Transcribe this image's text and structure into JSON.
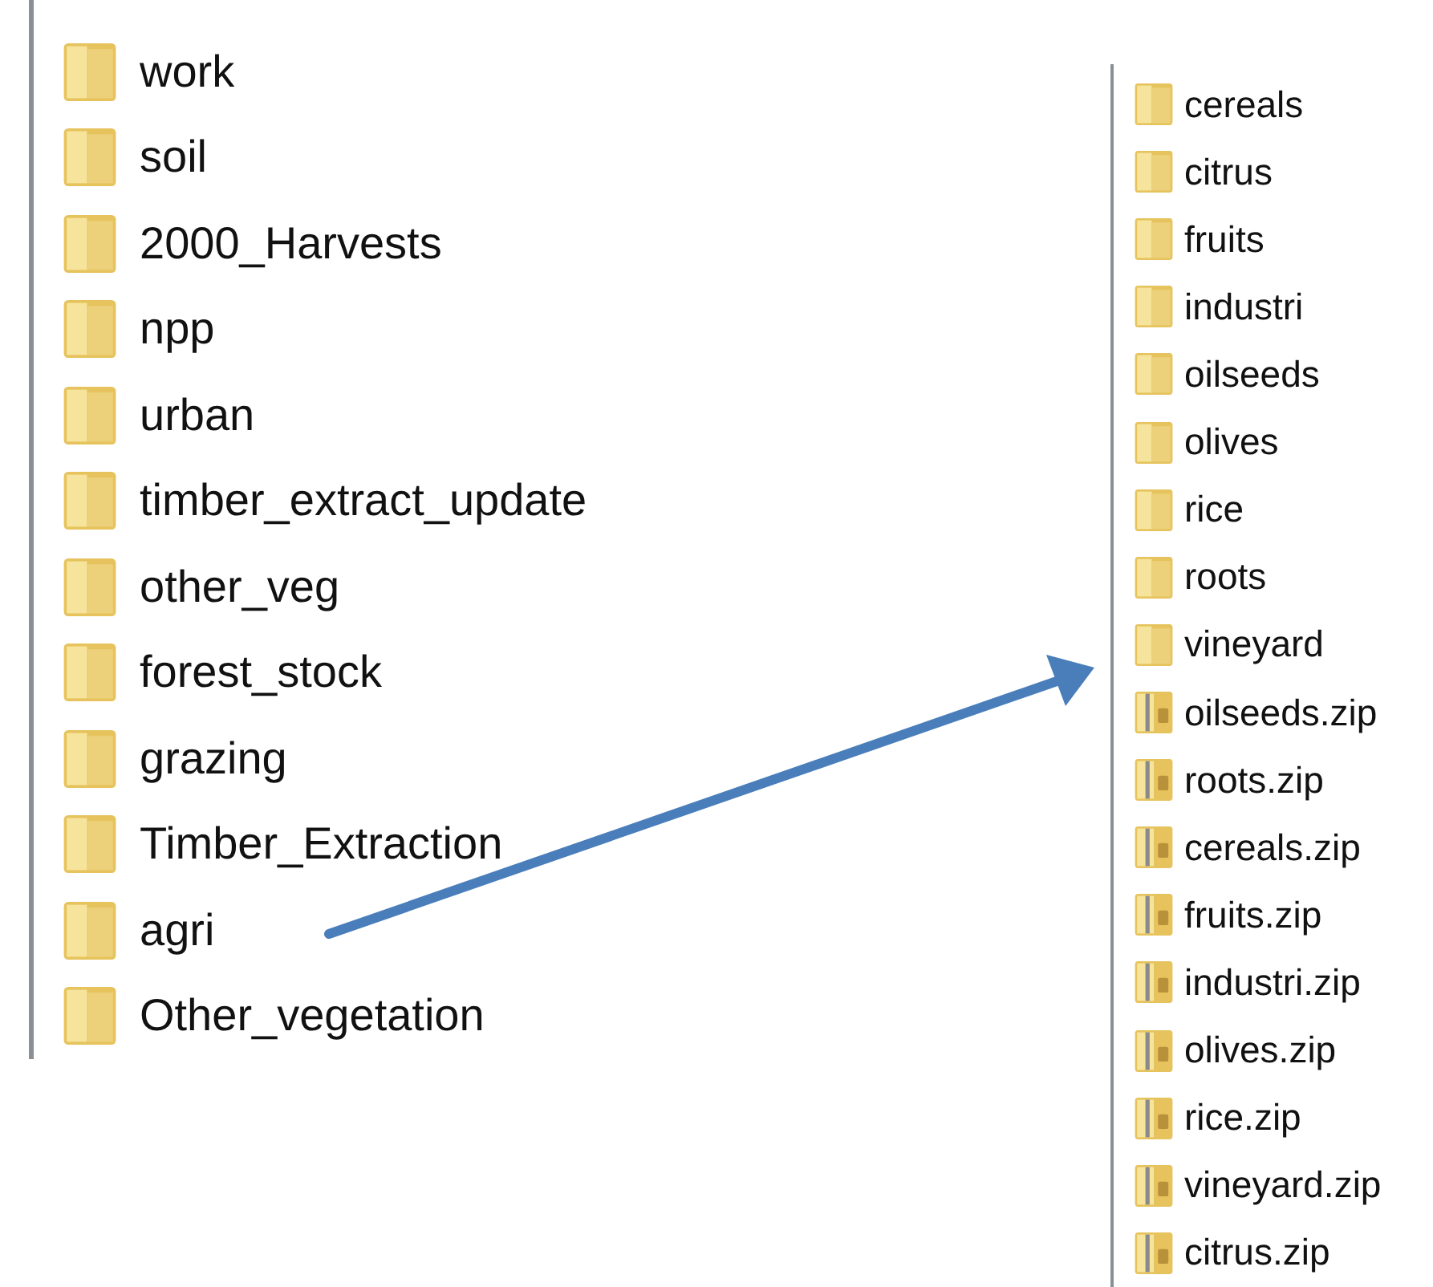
{
  "left_folder_list": {
    "items": [
      {
        "name": "work",
        "kind": "folder"
      },
      {
        "name": "soil",
        "kind": "folder"
      },
      {
        "name": "2000_Harvests",
        "kind": "folder"
      },
      {
        "name": "npp",
        "kind": "folder"
      },
      {
        "name": "urban",
        "kind": "folder"
      },
      {
        "name": "timber_extract_update",
        "kind": "folder"
      },
      {
        "name": "other_veg",
        "kind": "folder"
      },
      {
        "name": "forest_stock",
        "kind": "folder"
      },
      {
        "name": "grazing",
        "kind": "folder"
      },
      {
        "name": "Timber_Extraction",
        "kind": "folder"
      },
      {
        "name": "agri",
        "kind": "folder"
      },
      {
        "name": "Other_vegetation",
        "kind": "folder"
      }
    ]
  },
  "right_folder_list": {
    "items": [
      {
        "name": "cereals",
        "kind": "folder"
      },
      {
        "name": "citrus",
        "kind": "folder"
      },
      {
        "name": "fruits",
        "kind": "folder"
      },
      {
        "name": "industri",
        "kind": "folder"
      },
      {
        "name": "oilseeds",
        "kind": "folder"
      },
      {
        "name": "olives",
        "kind": "folder"
      },
      {
        "name": "rice",
        "kind": "folder"
      },
      {
        "name": "roots",
        "kind": "folder"
      },
      {
        "name": "vineyard",
        "kind": "folder"
      },
      {
        "name": "oilseeds.zip",
        "kind": "zip"
      },
      {
        "name": "roots.zip",
        "kind": "zip"
      },
      {
        "name": "cereals.zip",
        "kind": "zip"
      },
      {
        "name": "fruits.zip",
        "kind": "zip"
      },
      {
        "name": "industri.zip",
        "kind": "zip"
      },
      {
        "name": "olives.zip",
        "kind": "zip"
      },
      {
        "name": "rice.zip",
        "kind": "zip"
      },
      {
        "name": "vineyard.zip",
        "kind": "zip"
      },
      {
        "name": "citrus.zip",
        "kind": "zip"
      }
    ]
  }
}
